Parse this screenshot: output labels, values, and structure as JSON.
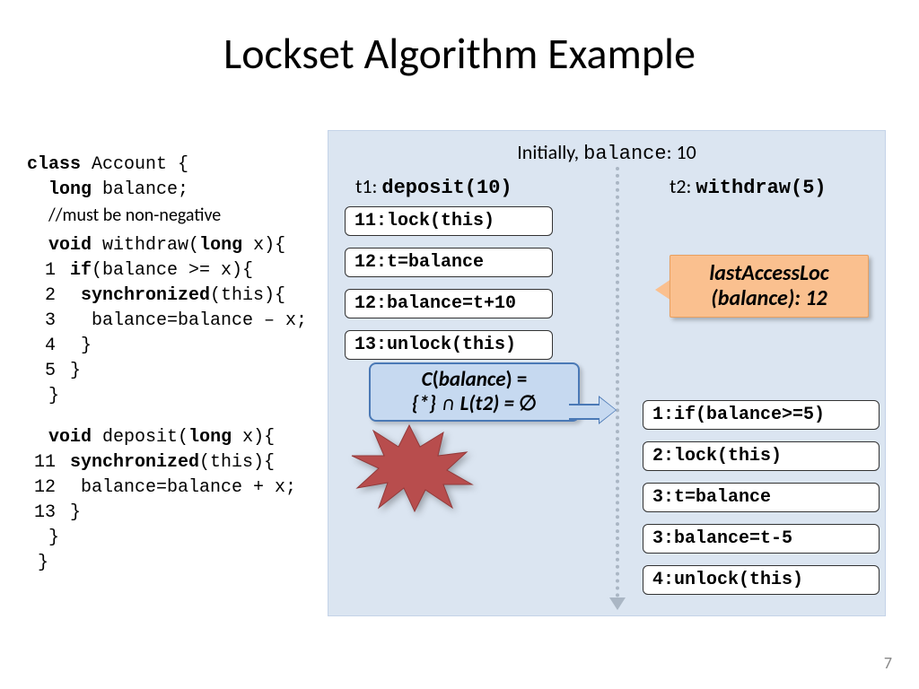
{
  "title": "Lockset Algorithm Example",
  "pagenum": "7",
  "code": {
    "l0": "class Account {",
    "l1": "  long balance;",
    "l2": "  //must be non-negative",
    "l3": "  void withdraw(long x){",
    "l4": "   if(balance >= x){",
    "l5": "    synchronized(this){",
    "l6": "     balance=balance – x;",
    "l7": "    }",
    "l8": "   }",
    "l9": "  }",
    "l10": "  void deposit(long x){",
    "l11": "   synchronized(this){",
    "l12": "    balance=balance + x;",
    "l13": "   }",
    "l14": "  }",
    "l15": " }"
  },
  "panel": {
    "initially_prefix": "Initially, ",
    "initially_mono": "balance",
    "initially_suffix": ": 10",
    "t1_label": "t1: ",
    "t1_call": "deposit(10)",
    "t2_label": "t2: ",
    "t2_call": "withdraw(5)",
    "t1_steps": {
      "s11": "11:lock(this)",
      "s12a": "12:t=balance",
      "s12b": "12:balance=t+10",
      "s13": "13:unlock(this)"
    },
    "t2_steps": {
      "s1": "1:if(balance>=5)",
      "s2": "2:lock(this)",
      "s3a": "3:t=balance",
      "s3b": "3:balance=t-5",
      "s4": "4:unlock(this)"
    },
    "callout": {
      "line1": "lastAccessLoc",
      "line2": "(balance): 12"
    },
    "cbox": {
      "line1": "C(balance) =",
      "line2": "{*} ∩ L(t2) = ∅"
    }
  }
}
